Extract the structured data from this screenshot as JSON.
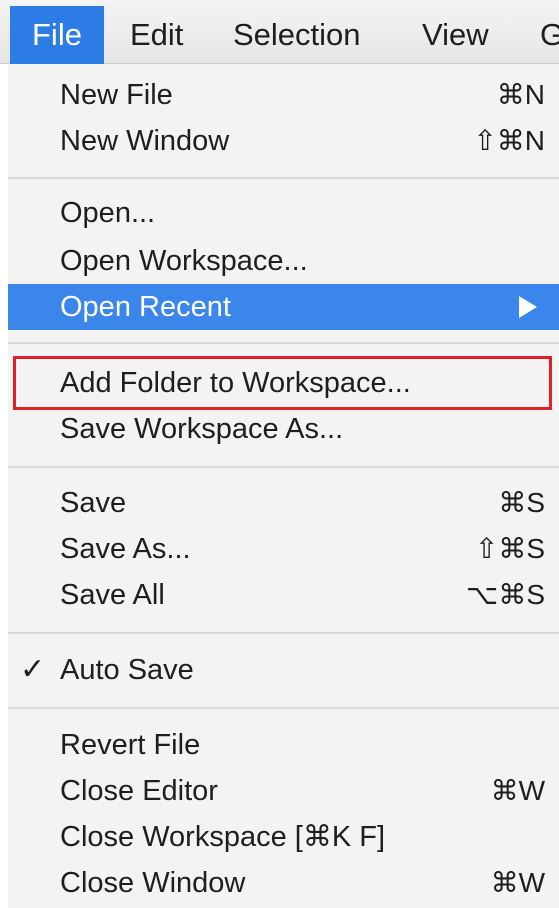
{
  "menubar": {
    "items": [
      "File",
      "Edit",
      "Selection",
      "View",
      "G"
    ]
  },
  "menu": {
    "new_file": {
      "label": "New File",
      "shortcut": "⌘N"
    },
    "new_window": {
      "label": "New Window",
      "shortcut": "⇧⌘N"
    },
    "open": {
      "label": "Open..."
    },
    "open_workspace": {
      "label": "Open Workspace..."
    },
    "open_recent": {
      "label": "Open Recent"
    },
    "add_folder": {
      "label": "Add Folder to Workspace..."
    },
    "save_workspace_as": {
      "label": "Save Workspace As..."
    },
    "save": {
      "label": "Save",
      "shortcut": "⌘S"
    },
    "save_as": {
      "label": "Save As...",
      "shortcut": "⇧⌘S"
    },
    "save_all": {
      "label": "Save All",
      "shortcut": "⌥⌘S"
    },
    "auto_save": {
      "label": "Auto Save",
      "check": "✓"
    },
    "revert_file": {
      "label": "Revert File"
    },
    "close_editor": {
      "label": "Close Editor",
      "shortcut": "⌘W"
    },
    "close_workspace": {
      "label": "Close Workspace [⌘K F]"
    },
    "close_window": {
      "label": "Close Window",
      "shortcut": "⌘W"
    }
  },
  "colors": {
    "highlight": "#3a86ea",
    "annotation": "#e0202a"
  }
}
